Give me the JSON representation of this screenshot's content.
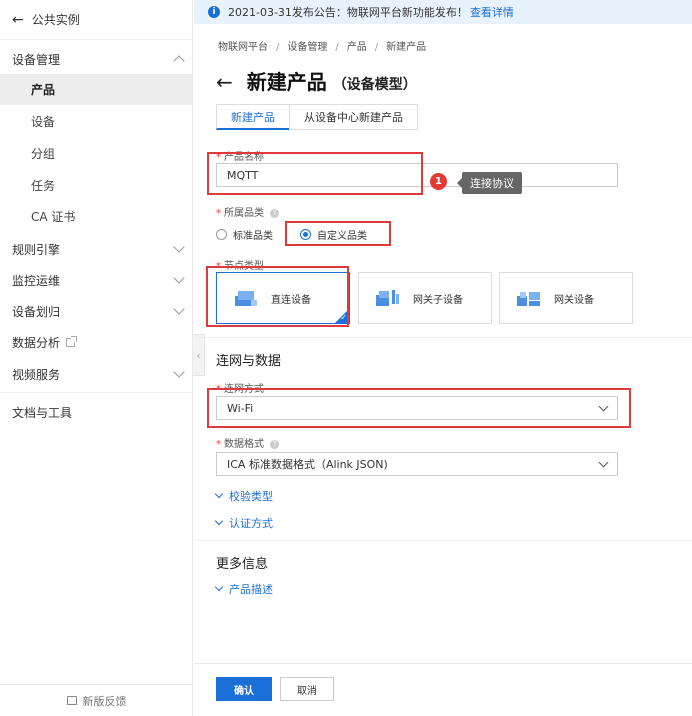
{
  "sidebar": {
    "back_label": "公共实例",
    "groups": [
      {
        "label": "设备管理"
      },
      {
        "label": "规则引擎"
      },
      {
        "label": "监控运维"
      },
      {
        "label": "设备划归"
      },
      {
        "label": "数据分析"
      },
      {
        "label": "视频服务"
      },
      {
        "label": "文档与工具"
      }
    ],
    "items": [
      {
        "label": "产品",
        "active": true
      },
      {
        "label": "设备"
      },
      {
        "label": "分组"
      },
      {
        "label": "任务"
      },
      {
        "label": "CA 证书"
      }
    ],
    "feedback": "新版反馈"
  },
  "notice": {
    "text": "2021-03-31发布公告：物联网平台新功能发布！",
    "link": "查看详情"
  },
  "breadcrumb": [
    "物联网平台",
    "设备管理",
    "产品",
    "新建产品"
  ],
  "page": {
    "title": "新建产品",
    "subtitle": "（设备模型）"
  },
  "tabs": [
    {
      "label": "新建产品",
      "active": true
    },
    {
      "label": "从设备中心新建产品"
    }
  ],
  "form": {
    "product_name_label": "产品名称",
    "product_name_value": "MQTT",
    "category_label": "所属品类",
    "category_options": [
      "标准品类",
      "自定义品类"
    ],
    "category_selected": "自定义品类",
    "node_type_label": "节点类型",
    "node_types": [
      {
        "label": "直连设备",
        "selected": true
      },
      {
        "label": "网关子设备"
      },
      {
        "label": "网关设备"
      }
    ],
    "section_network": "连网与数据",
    "network_label": "连网方式",
    "network_value": "Wi-Fi",
    "data_format_label": "数据格式",
    "data_format_value": "ICA 标准数据格式（Alink JSON)",
    "checksum_label": "校验类型",
    "auth_label": "认证方式",
    "section_more": "更多信息",
    "description_label": "产品描述"
  },
  "annotation": {
    "badge": "1",
    "tooltip": "连接协议"
  },
  "buttons": {
    "confirm": "确认",
    "cancel": "取消"
  },
  "colors": {
    "accent": "#1a6fd8",
    "highlight": "#e03a3a",
    "notice_bg": "#e8f2fd"
  }
}
